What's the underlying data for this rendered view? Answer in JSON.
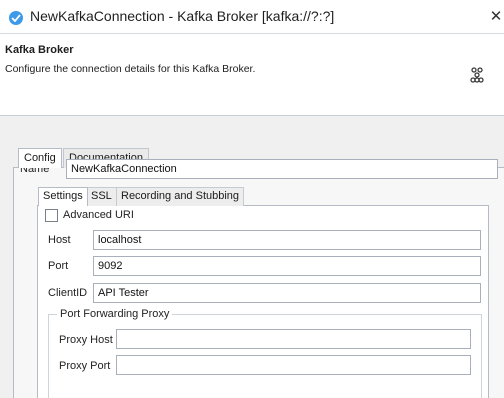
{
  "window": {
    "title": "NewKafkaConnection - Kafka Broker [kafka://?:?]",
    "close_glyph": "✕",
    "icon": "gear-icon"
  },
  "header": {
    "title": "Kafka Broker",
    "description": "Configure the connection details for this Kafka Broker.",
    "icon": "nodes-icon"
  },
  "outer_tabs": [
    {
      "label": "Config",
      "active": true
    },
    {
      "label": "Documentation",
      "active": false
    }
  ],
  "name_field": {
    "label": "Name",
    "value": "NewKafkaConnection"
  },
  "inner_tabs": [
    {
      "label": "Settings",
      "active": true
    },
    {
      "label": "SSL",
      "active": false
    },
    {
      "label": "Recording and Stubbing",
      "active": false
    }
  ],
  "settings": {
    "advanced_uri": {
      "label": "Advanced URI",
      "checked": false
    },
    "host": {
      "label": "Host",
      "value": "localhost"
    },
    "port": {
      "label": "Port",
      "value": "9092"
    },
    "client_id": {
      "label": "ClientID",
      "value": "API Tester"
    },
    "proxy_group": {
      "legend": "Port Forwarding Proxy",
      "proxy_host": {
        "label": "Proxy Host",
        "value": ""
      },
      "proxy_port": {
        "label": "Proxy Port",
        "value": ""
      }
    }
  },
  "colors": {
    "accent": "#3d9ae8",
    "panel_bg": "#f0f0f0",
    "border": "#b6bcc6"
  }
}
